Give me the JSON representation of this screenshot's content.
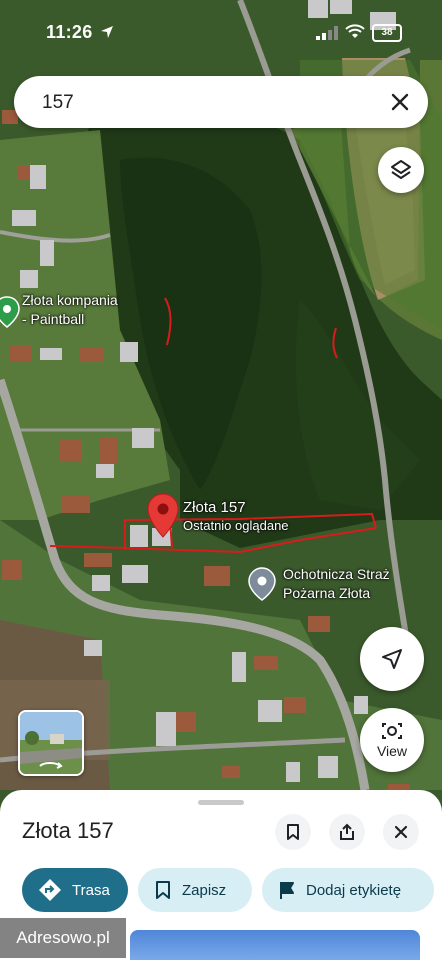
{
  "status_bar": {
    "time": "11:26",
    "battery": "38"
  },
  "search": {
    "query": "157"
  },
  "map": {
    "labels": {
      "poi_paintball_line1": "Złota kompania",
      "poi_paintball_line2": "- Paintball",
      "place_line1": "Złota 157",
      "place_line2": "Ostatnio oglądane",
      "fire_line1": "Ochotnicza Straż",
      "fire_line2": "Pożarna Złota"
    },
    "colors": {
      "pin": "#e53935",
      "drawing": "#d81b1b",
      "road": "#9e9e9e",
      "forest": "#2c4a22",
      "field": "#8a9a5b"
    }
  },
  "buttons": {
    "view_label": "View"
  },
  "sheet": {
    "title": "Złota 157",
    "actions": {
      "directions": "Trasa",
      "save": "Zapisz",
      "add_label": "Dodaj etykietę"
    }
  },
  "watermark": "Adresowo.pl"
}
